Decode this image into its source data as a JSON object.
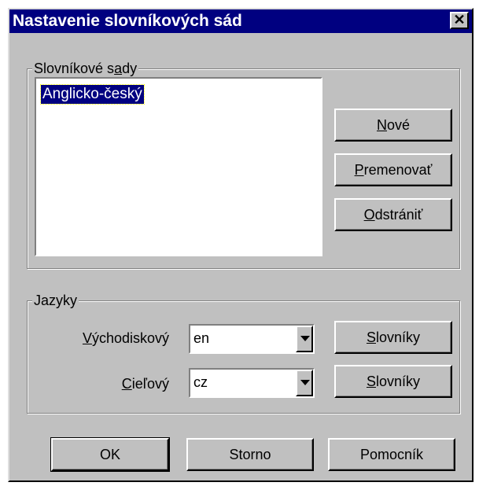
{
  "dialog": {
    "title": "Nastavenie slovníkových sád",
    "close_label": "✕"
  },
  "sets_group": {
    "legend_pre": "Slovníkové s",
    "legend_accel": "a",
    "legend_post": "dy",
    "items": [
      "Anglicko-český"
    ],
    "new_accel": "N",
    "new_rest": "ové",
    "rename_accel": "P",
    "rename_rest": "remenovať",
    "delete_accel": "O",
    "delete_rest": "dstrániť"
  },
  "languages_group": {
    "legend": "Jazyky",
    "source_accel": "V",
    "source_rest": "ýchodiskový",
    "source_value": "en",
    "target_accel": "C",
    "target_rest": "ieľový",
    "target_value": "cz",
    "dict_accel": "S",
    "dict_rest": "lovníky"
  },
  "footer": {
    "ok": "OK",
    "cancel": "Storno",
    "help": "Pomocník"
  }
}
